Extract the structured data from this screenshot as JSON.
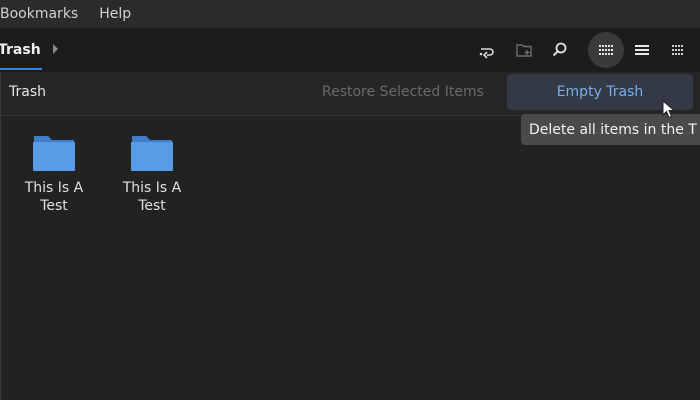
{
  "menubar": {
    "items": [
      "Bookmarks",
      "Help"
    ]
  },
  "toolbar": {
    "location": "Trash",
    "icons": [
      "history-icon",
      "new-folder-icon",
      "search-icon",
      "grid-view-icon",
      "list-view-icon",
      "options-icon"
    ]
  },
  "actionbar": {
    "title": "Trash",
    "restore_label": "Restore Selected Items",
    "empty_label": "Empty Trash"
  },
  "tooltip": {
    "text": "Delete all items in the T"
  },
  "files": [
    {
      "label": "This Is A Test",
      "icon": "folder-icon"
    },
    {
      "label": "This Is A Test",
      "icon": "folder-icon"
    }
  ],
  "colors": {
    "accent": "#3584e4",
    "button_text": "#78aeed",
    "folder": "#5a9be6"
  }
}
